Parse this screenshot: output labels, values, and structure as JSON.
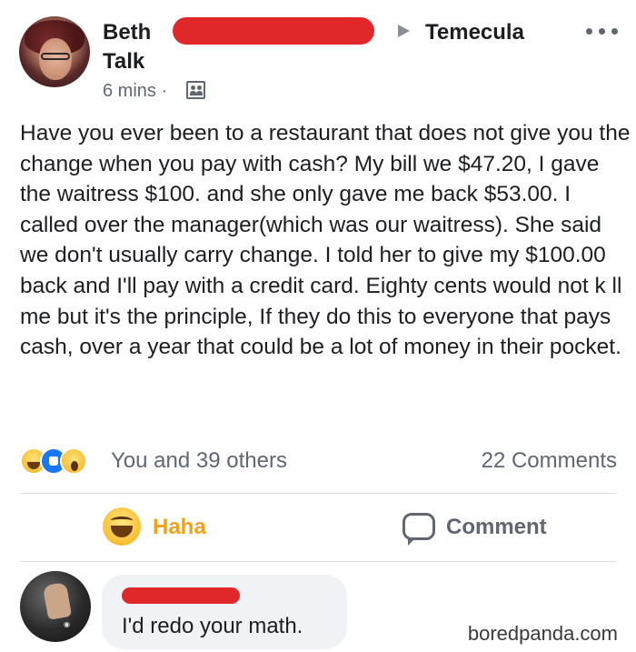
{
  "post": {
    "author": "Beth Talk",
    "location": "Temecula",
    "time": "6 mins ·",
    "text": "Have you ever been to a restaurant that does not give you the change when you pay with cash? My bill we $47.20, I gave the waitress $100. and she only gave me back $53.00. I called over the manager(which was our waitress). She said we don't usually carry change. I told her to give my $100.00 back and I'll pay with a credit card. Eighty cents would not k ll me but it's the principle, If they do this to everyone that pays cash, over a year that could be a lot of money in their pocket.",
    "reactions": {
      "icons": [
        "haha-icon",
        "like-icon",
        "wow-icon"
      ],
      "summary": "You and 39 others",
      "comments_count": "22 Comments"
    }
  },
  "actions": {
    "haha_label": "Haha",
    "comment_label": "Comment"
  },
  "comment": {
    "text": "I'd redo your math."
  },
  "watermark": "boredpanda.com",
  "colors": {
    "redaction": "#e0282b",
    "haha_orange": "#f0a21a",
    "muted": "#606770",
    "like_blue": "#1877f2"
  }
}
